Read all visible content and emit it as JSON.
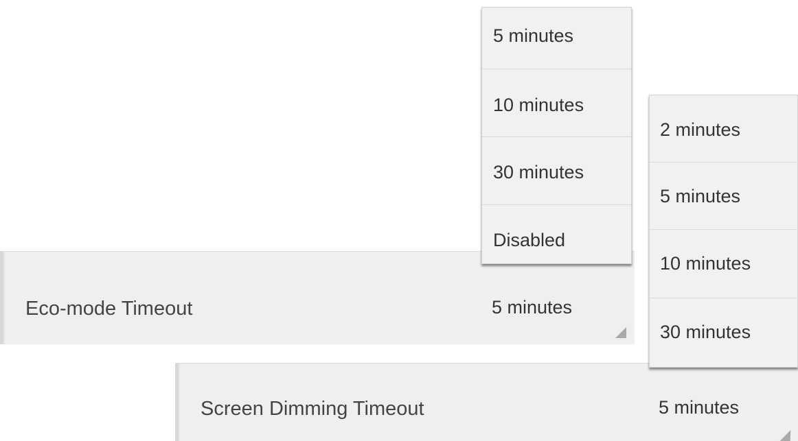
{
  "eco_mode": {
    "label": "Eco-mode Timeout",
    "value": "5 minutes",
    "options": [
      "5 minutes",
      "10 minutes",
      "30 minutes",
      "Disabled"
    ]
  },
  "screen_dimming": {
    "label": "Screen Dimming Timeout",
    "value": "5 minutes",
    "options": [
      "2 minutes",
      "5 minutes",
      "10 minutes",
      "30 minutes"
    ]
  }
}
